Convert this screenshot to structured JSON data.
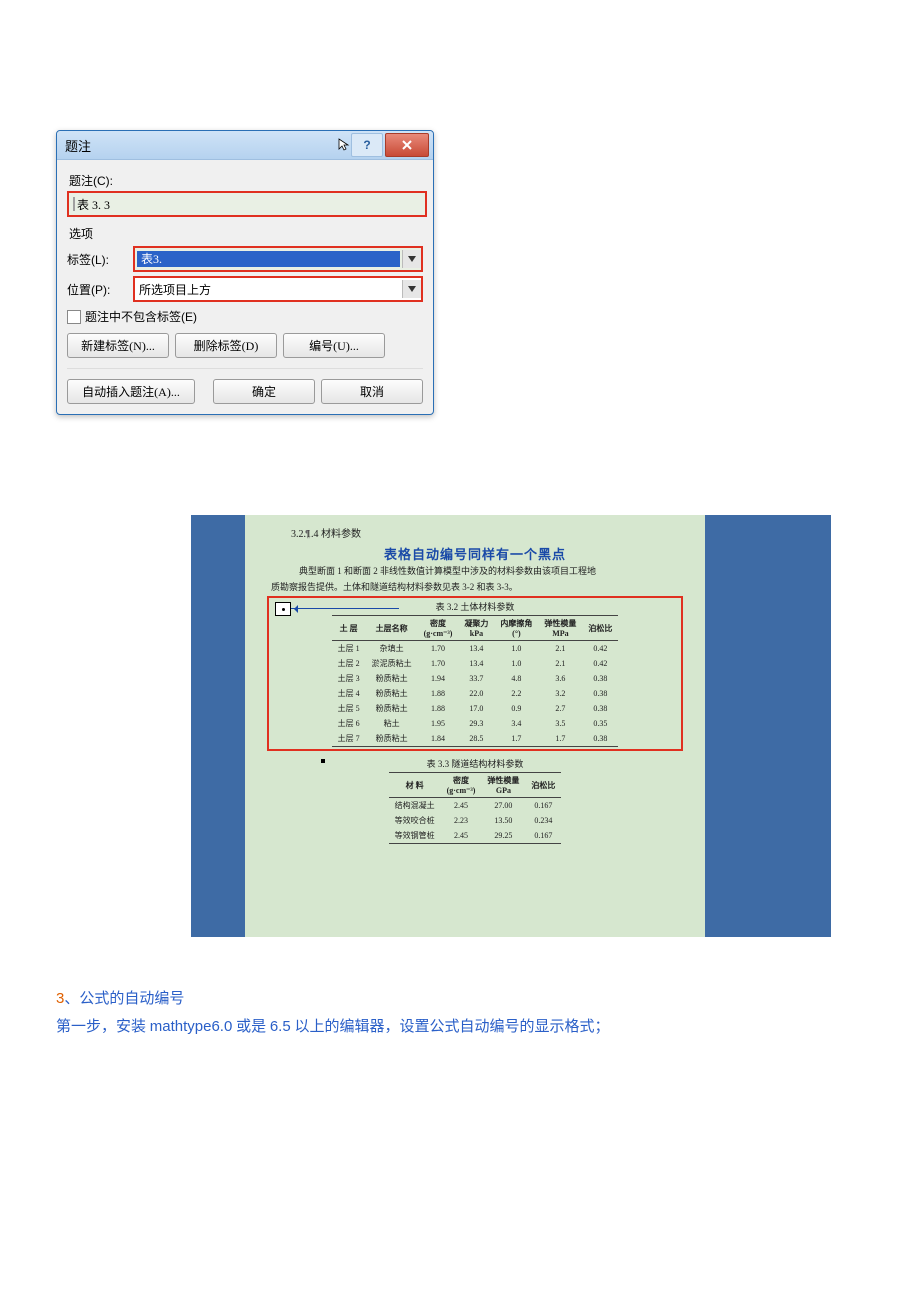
{
  "dialog": {
    "title": "题注",
    "caption_label": "题注(C):",
    "caption_value": "表 3. 3",
    "options_section": "选项",
    "label_label": "标签(L):",
    "label_value": "表3.",
    "position_label": "位置(P):",
    "position_value": "所选项目上方",
    "exclude_label_chk": "题注中不包含标签(E)",
    "btn_new_label": "新建标签(N)...",
    "btn_del_label": "删除标签(D)",
    "btn_numbering": "编号(U)...",
    "btn_auto": "自动插入题注(A)...",
    "btn_ok": "确定",
    "btn_cancel": "取消"
  },
  "doc": {
    "heading": "3.2.1.4 材料参数",
    "callout": "表格自动编号同样有一个黑点",
    "body_line1": "典型断面 1 和断面 2 非线性数值计算模型中涉及的材料参数由该项目工程地",
    "body_line2": "质勘察报告提供。土体和隧道结构材料参数见表 3-2 和表 3-3。",
    "table32": {
      "caption": "表 3.2  土体材料参数",
      "headers": [
        "土 层",
        "土层名称",
        "密度\n(g·cm⁻³)",
        "凝聚力\nkPa",
        "内摩擦角\n(°)",
        "弹性模量\nMPa",
        "泊松比"
      ],
      "rows": [
        [
          "土层 1",
          "杂填土",
          "1.70",
          "13.4",
          "1.0",
          "2.1",
          "0.42"
        ],
        [
          "土层 2",
          "淤泥质粘土",
          "1.70",
          "13.4",
          "1.0",
          "2.1",
          "0.42"
        ],
        [
          "土层 3",
          "粉质粘土",
          "1.94",
          "33.7",
          "4.8",
          "3.6",
          "0.38"
        ],
        [
          "土层 4",
          "粉质粘土",
          "1.88",
          "22.0",
          "2.2",
          "3.2",
          "0.38"
        ],
        [
          "土层 5",
          "粉质粘土",
          "1.88",
          "17.0",
          "0.9",
          "2.7",
          "0.38"
        ],
        [
          "土层 6",
          "粘土",
          "1.95",
          "29.3",
          "3.4",
          "3.5",
          "0.35"
        ],
        [
          "土层 7",
          "粉质粘土",
          "1.84",
          "28.5",
          "1.7",
          "1.7",
          "0.38"
        ]
      ]
    },
    "table33": {
      "caption": "表 3.3  隧道结构材料参数",
      "headers": [
        "材   料",
        "密度\n(g·cm⁻³)",
        "弹性模量\nGPa",
        "泊松比"
      ],
      "rows": [
        [
          "结构混凝土",
          "2.45",
          "27.00",
          "0.167"
        ],
        [
          "等效咬合桩",
          "2.23",
          "13.50",
          "0.234"
        ],
        [
          "等效钢管桩",
          "2.45",
          "29.25",
          "0.167"
        ]
      ]
    }
  },
  "paragraphs": {
    "p1_num": "3",
    "p1_rest": "、公式的自动编号",
    "p2_a": "第一步，安装 ",
    "p2_b": "mathtype6.0",
    "p2_c": " 或是 ",
    "p2_d": "6.5",
    "p2_e": " 以上的编辑器，设置公式自动编号的显示格式；"
  }
}
